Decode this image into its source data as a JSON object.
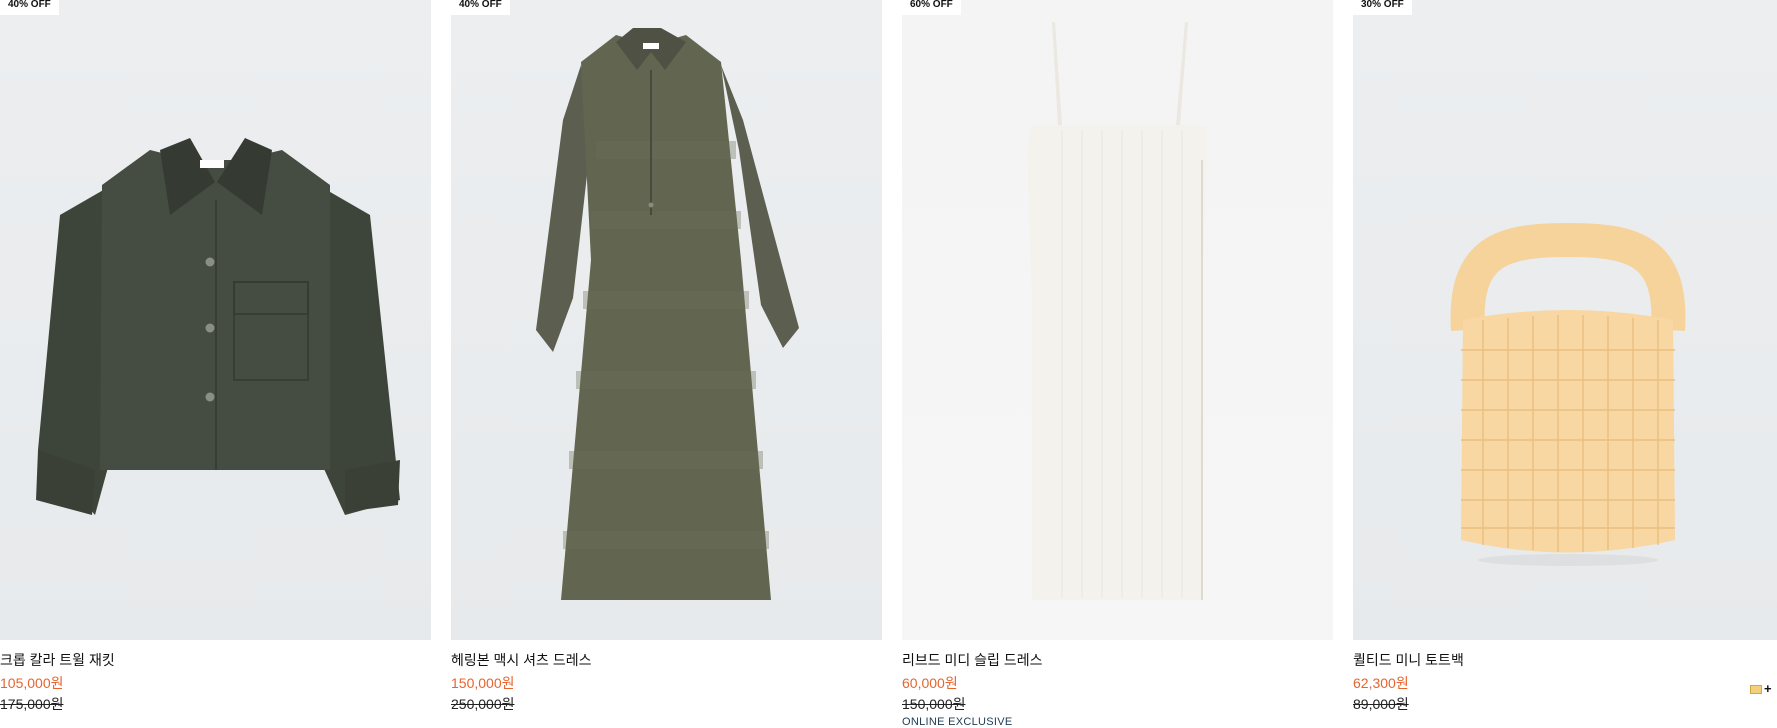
{
  "products": [
    {
      "badge": "40% OFF",
      "name": "크롭 칼라 트윌 재킷",
      "sale_price": "105,000원",
      "original_price": "175,000원",
      "tag": ""
    },
    {
      "badge": "40% OFF",
      "name": "헤링본 맥시 셔츠 드레스",
      "sale_price": "150,000원",
      "original_price": "250,000원",
      "tag": ""
    },
    {
      "badge": "60% OFF",
      "name": "리브드 미디 슬립 드레스",
      "sale_price": "60,000원",
      "original_price": "150,000원",
      "tag": "ONLINE EXCLUSIVE"
    },
    {
      "badge": "30% OFF",
      "name": "퀼티드 미니 토트백",
      "sale_price": "62,300원",
      "original_price": "89,000원",
      "tag": ""
    }
  ],
  "corner_widget": {
    "icon": "envelope-icon",
    "plus": "+"
  }
}
